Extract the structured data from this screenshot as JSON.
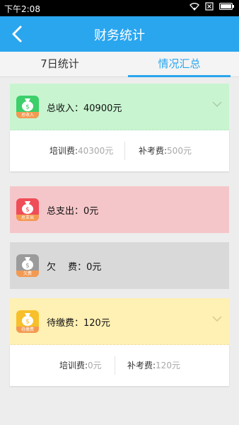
{
  "status_bar": {
    "time": "下午2:08"
  },
  "nav": {
    "title": "财务统计"
  },
  "tabs": [
    {
      "label": "7日统计",
      "active": false
    },
    {
      "label": "情况汇总",
      "active": true
    }
  ],
  "income": {
    "icon_tag": "总收入",
    "label": "总收入：40900元",
    "color": "#c8f5d0",
    "icon_color": "#3ccf6a",
    "items": [
      {
        "key": "培训费:",
        "value": "40300元"
      },
      {
        "key": "补考费:",
        "value": "500元"
      }
    ]
  },
  "expense": {
    "icon_tag": "总支出",
    "label": "总支出：0元",
    "color": "#f5c6c9",
    "icon_color": "#ef4d58"
  },
  "owed": {
    "icon_tag": "欠费",
    "label": "欠　 费：0元",
    "color": "#d9d9d9",
    "icon_color": "#9b9b9b"
  },
  "pending": {
    "icon_tag": "待缴费",
    "label": "待缴费：120元",
    "color": "#fff0b3",
    "icon_color": "#f7c02a",
    "items": [
      {
        "key": "培训费:",
        "value": "0元"
      },
      {
        "key": "补考费:",
        "value": "120元"
      }
    ]
  }
}
